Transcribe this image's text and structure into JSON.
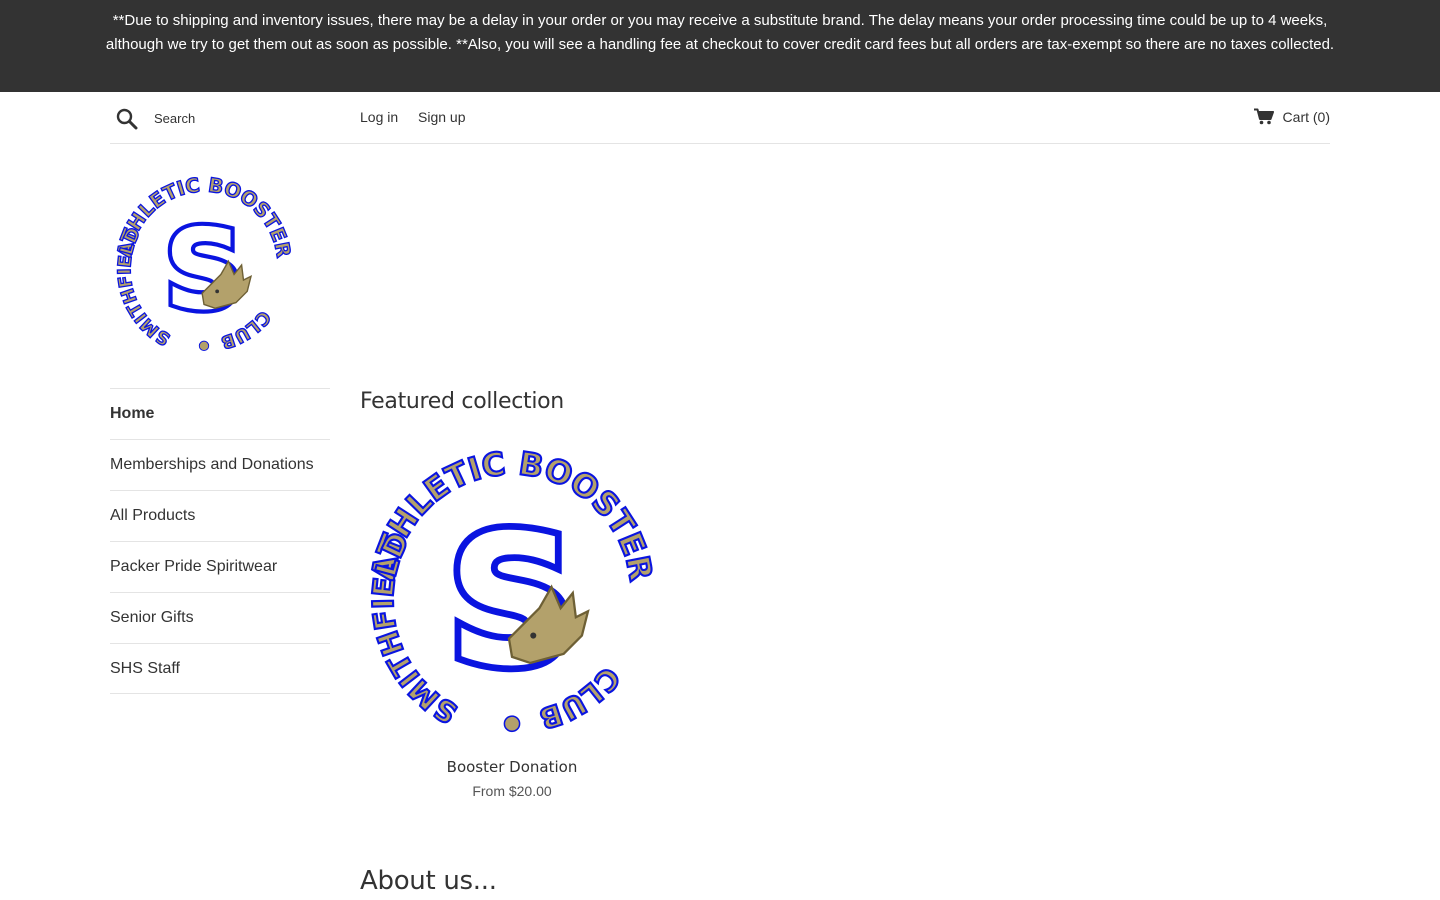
{
  "announcement": {
    "text": "**Due to shipping and inventory issues, there may be a delay in your order or you may receive a substitute brand. The delay means your order processing time could be up to 4 weeks, although we try to get them out as soon as possible. **Also, you will see a handling fee at checkout to cover credit card fees but all orders are tax-exempt so there are no taxes collected."
  },
  "header": {
    "search_placeholder": "Search",
    "login_label": "Log in",
    "signup_label": "Sign up",
    "cart_label": "Cart (0)"
  },
  "logo": {
    "top_text": "ATHLETIC BOOSTER",
    "left_text": "SMITHFIELD",
    "bottom_text": "CLUB",
    "letter": "S"
  },
  "sidebar": {
    "items": [
      {
        "label": "Home",
        "active": true
      },
      {
        "label": "Memberships and Donations"
      },
      {
        "label": "All Products"
      },
      {
        "label": "Packer Pride Spiritwear"
      },
      {
        "label": "Senior Gifts"
      },
      {
        "label": "SHS Staff"
      }
    ]
  },
  "featured": {
    "title": "Featured collection",
    "product": {
      "name": "Booster Donation",
      "price": "From $20.00"
    }
  },
  "about": {
    "title": "About us..."
  },
  "colors": {
    "announcement_bg": "#333333",
    "logo_blue": "#0a14e0",
    "logo_gold": "#b3a16b"
  },
  "icons": {
    "search": "search-icon",
    "cart": "cart-icon",
    "mascot": "boar-mascot-icon"
  }
}
